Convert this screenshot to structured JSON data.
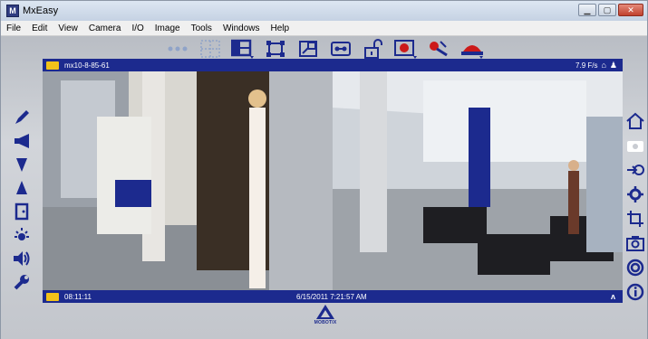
{
  "window": {
    "title": "MxEasy",
    "controls": [
      "minimize",
      "maximize",
      "close"
    ]
  },
  "menu": [
    "File",
    "Edit",
    "View",
    "Camera",
    "I/O",
    "Image",
    "Tools",
    "Windows",
    "Help"
  ],
  "toolbar": {
    "buttons": [
      {
        "name": "more-dots-icon"
      },
      {
        "name": "layout-grid-icon"
      },
      {
        "name": "view-layout-icon",
        "dropdown": true
      },
      {
        "name": "fullscreen-icon"
      },
      {
        "name": "resize-window-icon"
      },
      {
        "name": "cassette-icon"
      },
      {
        "name": "unlock-icon"
      },
      {
        "name": "record-icon",
        "dropdown": true
      },
      {
        "name": "mic-plug-icon"
      },
      {
        "name": "alarm-light-icon",
        "dropdown": true
      }
    ]
  },
  "camera": {
    "name": "mx10-8-85-61",
    "fps": "7.9 F/s",
    "time": "08:11:11",
    "datetime": "6/15/2011 7:21:57 AM"
  },
  "left_panel": [
    "pen-icon",
    "megaphone-icon",
    "triangle-down-icon",
    "triangle-up-icon",
    "door-icon",
    "brightness-icon",
    "speaker-icon",
    "wrench-icon"
  ],
  "right_panel": [
    "home-icon",
    "camera-switch-icon",
    "login-arrow-icon",
    "gear-icon",
    "crop-icon",
    "snapshot-icon",
    "lifebuoy-icon",
    "info-icon"
  ],
  "logo": {
    "text": "MOBOTIX"
  },
  "colors": {
    "accent": "#1c2a8e",
    "icon": "#1c2a8e",
    "record": "#cc1a1a",
    "badge": "#f2c21a"
  }
}
